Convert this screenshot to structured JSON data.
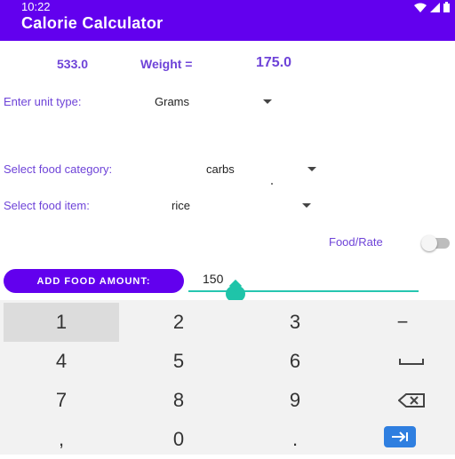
{
  "status_bar": {
    "time": "10:22"
  },
  "app_bar": {
    "title": "Calorie Calculator"
  },
  "summary": {
    "calories": "533.0",
    "weight_label": "Weight =",
    "weight_value": "175.0"
  },
  "unit": {
    "label": "Enter unit type:",
    "value": "Grams"
  },
  "category": {
    "label": "Select food category:",
    "value": "carbs"
  },
  "item": {
    "label": "Select food item:",
    "value": "rice"
  },
  "toggle": {
    "label": "Food/Rate",
    "on": false
  },
  "amount": {
    "button_label": "ADD FOOD AMOUNT:",
    "value": "150"
  },
  "keyboard": {
    "keys": [
      "1",
      "2",
      "3",
      "−",
      "4",
      "5",
      "6",
      "space",
      "7",
      "8",
      "9",
      "backspace",
      ",",
      "0",
      ".",
      "enter"
    ]
  },
  "colors": {
    "accent": "#6200ee",
    "label": "#6e43d8",
    "teal": "#1fc4a9",
    "enter": "#2f7fe0"
  }
}
